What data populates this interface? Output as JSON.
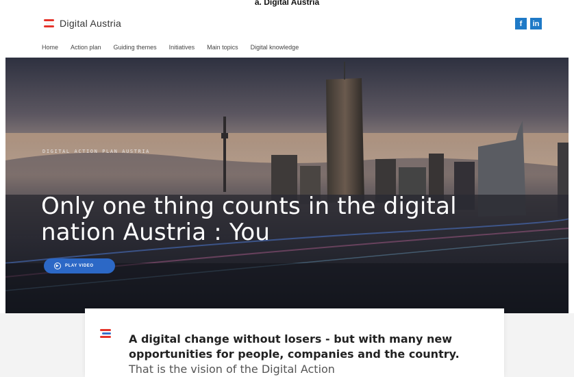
{
  "caption": "a. Digital Austria",
  "header": {
    "logo_text": "Digital Austria",
    "social": [
      {
        "icon": "facebook-icon",
        "label": "f"
      },
      {
        "icon": "linkedin-icon",
        "label": "in"
      }
    ]
  },
  "nav": {
    "items": [
      "Home",
      "Action plan",
      "Guiding themes",
      "Initiatives",
      "Main topics",
      "Digital knowledge"
    ]
  },
  "hero": {
    "eyebrow": "DIGITAL ACTION PLAN AUSTRIA",
    "headline": "Only one thing counts in the digital nation Austria : You",
    "play_label": "PLAY VIDEO"
  },
  "intro": {
    "bold": "A digital change without losers - but with many new opportunities for people, companies and the country.",
    "rest": " That is the vision of the Digital Action"
  },
  "colors": {
    "accent_red": "#e5332a",
    "accent_blue": "#2c68c6",
    "social_blue": "#1f7ac7"
  }
}
